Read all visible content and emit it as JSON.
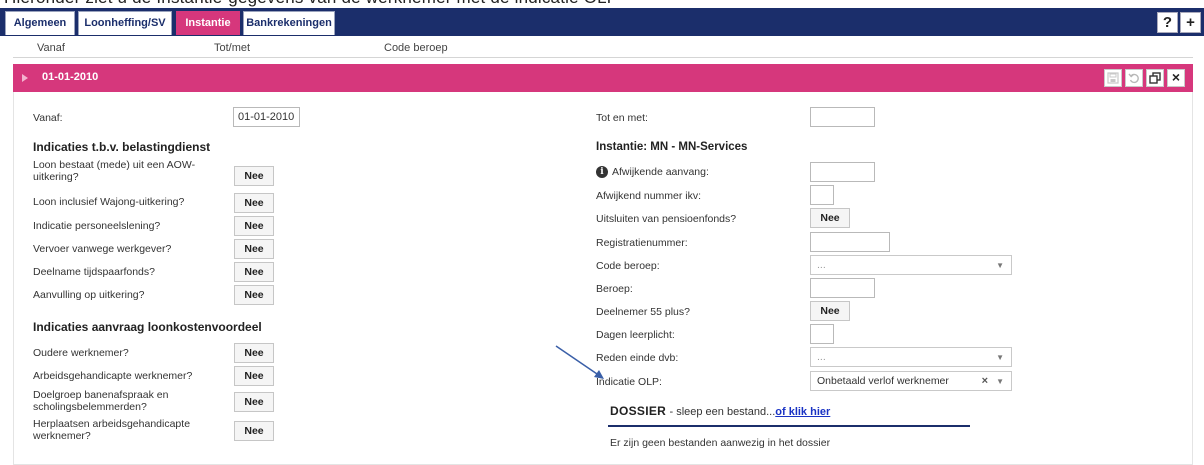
{
  "top_caption": "Hieronder ziet u de Instantie-gegevens van de werknemer met de indicatie OLP",
  "tabs": [
    {
      "label": "Algemeen",
      "active": false
    },
    {
      "label": "Loonheffing/SV",
      "active": false
    },
    {
      "label": "Instantie",
      "active": true
    },
    {
      "label": "Bankrekeningen",
      "active": false
    }
  ],
  "toolbar": {
    "help_label": "?",
    "add_label": "+"
  },
  "columns": [
    "Vanaf",
    "Tot/met",
    "Code beroep"
  ],
  "panel": {
    "title": "01-01-2010",
    "icons": [
      "save-icon",
      "undo-icon",
      "copy-icon",
      "close-icon"
    ],
    "close_label": "×"
  },
  "left": {
    "vanaf_label": "Vanaf:",
    "vanaf_value": "01-01-2010",
    "section1_title": "Indicaties t.b.v. belastingdienst",
    "section1_items": [
      {
        "label": "Loon bestaat (mede) uit een AOW-uitkering?",
        "value": "Nee"
      },
      {
        "label": "Loon inclusief Wajong-uitkering?",
        "value": "Nee"
      },
      {
        "label": "Indicatie personeelslening?",
        "value": "Nee"
      },
      {
        "label": "Vervoer vanwege werkgever?",
        "value": "Nee"
      },
      {
        "label": "Deelname tijdspaarfonds?",
        "value": "Nee"
      },
      {
        "label": "Aanvulling op uitkering?",
        "value": "Nee"
      }
    ],
    "section2_title": "Indicaties aanvraag loonkostenvoordeel",
    "section2_items": [
      {
        "label": "Oudere werknemer?",
        "value": "Nee"
      },
      {
        "label": "Arbeidsgehandicapte werknemer?",
        "value": "Nee"
      },
      {
        "label": "Doelgroep banenafspraak en scholingsbelemmerden?",
        "value": "Nee"
      },
      {
        "label": "Herplaatsen arbeidsgehandicapte werknemer?",
        "value": "Nee"
      }
    ]
  },
  "right": {
    "tot_en_met_label": "Tot en met:",
    "tot_en_met_value": "",
    "instantie_title": "Instantie: MN - MN-Services",
    "afwijkende_aanvang_label": "Afwijkende aanvang:",
    "afwijkend_nummer_label": "Afwijkend nummer ikv:",
    "uitsluiten_label": "Uitsluiten van pensioenfonds?",
    "uitsluiten_value": "Nee",
    "registratienummer_label": "Registratienummer:",
    "code_beroep_label": "Code beroep:",
    "code_beroep_value": "...",
    "beroep_label": "Beroep:",
    "deelnemer_label": "Deelnemer 55 plus?",
    "deelnemer_value": "Nee",
    "dagen_label": "Dagen leerplicht:",
    "reden_label": "Reden einde dvb:",
    "reden_value": "...",
    "olp_label": "Indicatie OLP:",
    "olp_value": "Onbetaald verlof werknemer",
    "clear_label": "×",
    "caret_label": "▼"
  },
  "dossier": {
    "title": "DOSSIER",
    "subtitle": "- sleep een bestand...",
    "link": "of klik hier",
    "empty_text": "Er zijn geen bestanden aanwezig in het dossier"
  },
  "colors": {
    "navy": "#1b2e6b",
    "accent": "#d6377c",
    "link": "#1a33c4",
    "arrow": "#3a5fa8"
  }
}
